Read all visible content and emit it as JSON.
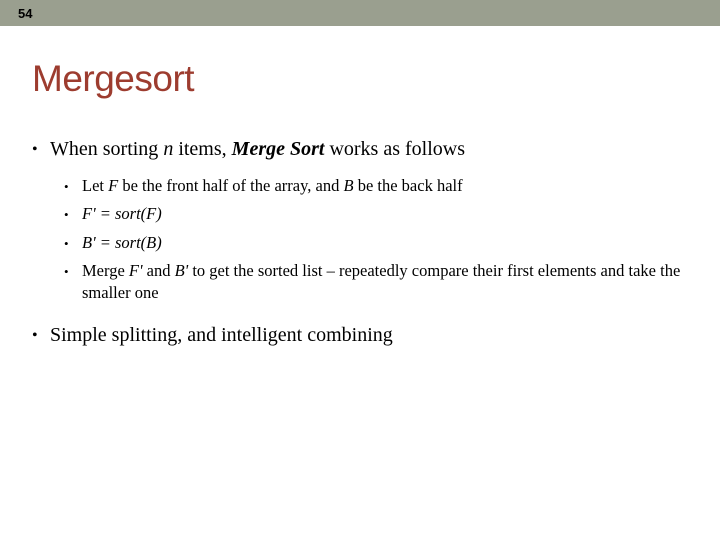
{
  "slide": {
    "number": "54",
    "title": "Mergesort"
  },
  "outline": {
    "l1_intro": {
      "pre": "When sorting ",
      "n": "n",
      "mid": " items, ",
      "merge_sort": "Merge Sort",
      "post": " works as follows"
    },
    "sub": {
      "let_line": {
        "s0": "Let ",
        "F": "F",
        "s1": " be the front half of the array, and ",
        "B": "B",
        "s2": " be the back half"
      },
      "fprime": "F' = sort(F)",
      "bprime": "B' = sort(B)",
      "merge_line": {
        "s0": "Merge ",
        "Fp": "F'",
        "s1": " and ",
        "Bp": "B'",
        "s2": " to get the sorted list – repeatedly compare their first elements and take the smaller one"
      }
    },
    "l1_close": "Simple splitting, and intelligent combining"
  }
}
